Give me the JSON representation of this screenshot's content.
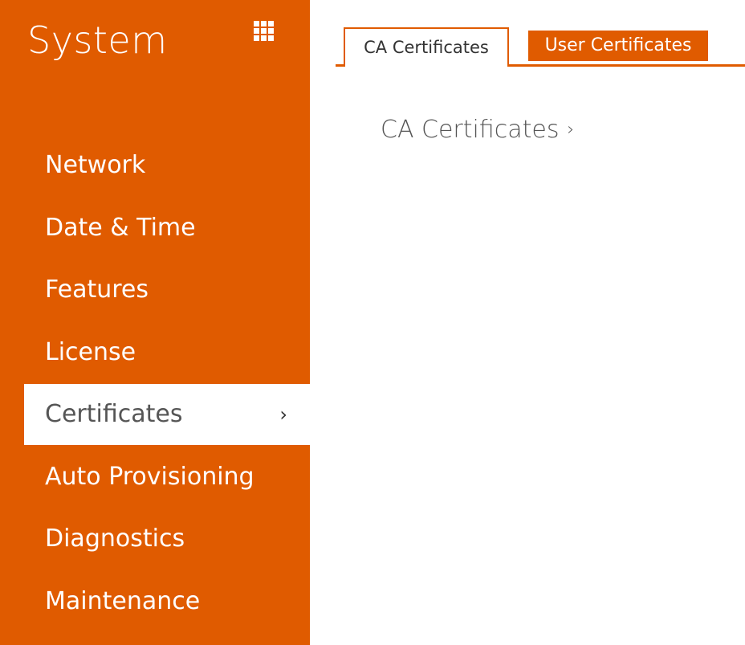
{
  "sidebar": {
    "title": "System",
    "menu_icon": "grid-menu-icon",
    "items": [
      {
        "label": "Network",
        "active": false
      },
      {
        "label": "Date & Time",
        "active": false
      },
      {
        "label": "Features",
        "active": false
      },
      {
        "label": "License",
        "active": false
      },
      {
        "label": "Certificates",
        "active": true,
        "chevron": "›"
      },
      {
        "label": "Auto Provisioning",
        "active": false
      },
      {
        "label": "Diagnostics",
        "active": false
      },
      {
        "label": "Maintenance",
        "active": false
      }
    ]
  },
  "tabs": [
    {
      "label": "CA Certificates",
      "active": true
    },
    {
      "label": "User Certificates",
      "active": false
    }
  ],
  "main": {
    "section_title": "CA Certificates",
    "section_chevron": "›"
  },
  "colors": {
    "accent": "#e05b00",
    "background": "#ffffff",
    "text_dark": "#555555"
  }
}
